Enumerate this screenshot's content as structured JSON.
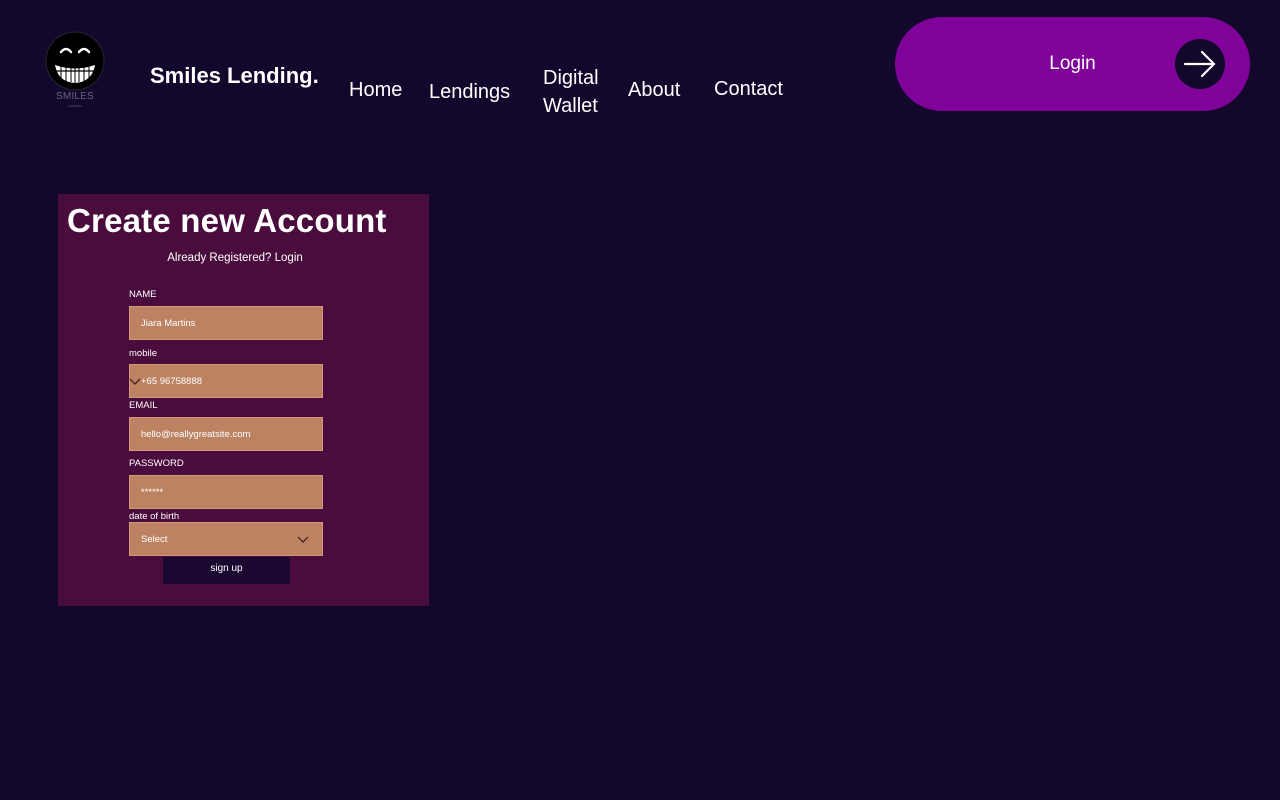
{
  "header": {
    "logo_text": "SMILES",
    "logo_subtext": "LENDING",
    "brand": "Smiles Lending.",
    "nav": {
      "home": "Home",
      "lendings": "Lendings",
      "wallet_line1": "Digital",
      "wallet_line2": "Wallet",
      "about": "About",
      "contact": "Contact"
    },
    "login_label": "Login"
  },
  "form": {
    "title": "Create new Account",
    "subtitle": "Already Registered? Login",
    "name_label": "NAME",
    "name_value": "Jiara Martins",
    "mobile_label": "mobile",
    "mobile_value": "+65 96758888",
    "email_label": "EMAIL",
    "email_value": "hello@reallygreatsite.com",
    "password_label": "PASSWORD",
    "password_value": "******",
    "dob_label": "date of birth",
    "dob_value": "Select",
    "submit_label": "sign up"
  },
  "colors": {
    "background": "#13072c",
    "card": "#4a0c3c",
    "field": "#bd8262",
    "accent": "#7f0399",
    "button_dark": "#1a0830"
  },
  "icons": {
    "logo": "grinning-face-icon",
    "login": "arrow-right-icon",
    "dropdown": "chevron-down-icon"
  }
}
